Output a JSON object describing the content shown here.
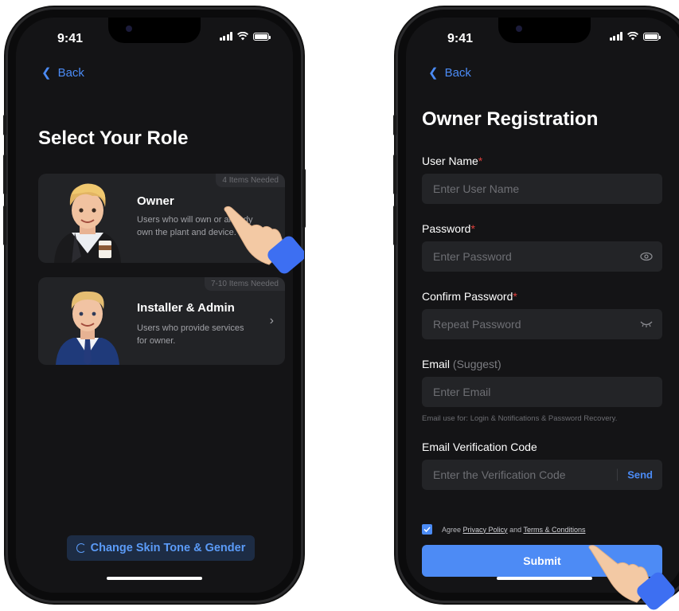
{
  "status": {
    "time": "9:41"
  },
  "nav": {
    "back_label": "Back"
  },
  "role_screen": {
    "title": "Select Your Role",
    "cards": [
      {
        "badge": "4 Items Needed",
        "name": "Owner",
        "description": "Users who will own or already own the plant and device."
      },
      {
        "badge": "7-10 Items Needed",
        "name": "Installer & Admin",
        "description": "Users who provide services for owner."
      }
    ],
    "skin_button": "Change Skin Tone & Gender"
  },
  "registration": {
    "title": "Owner Registration",
    "fields": [
      {
        "label": "User Name",
        "required": "*",
        "placeholder": "Enter User Name"
      },
      {
        "label": "Password",
        "required": "*",
        "placeholder": "Enter Password"
      },
      {
        "label": "Confirm Password",
        "required": "*",
        "placeholder": "Repeat Password"
      },
      {
        "label": "Email",
        "optional": "(Suggest)",
        "placeholder": "Enter Email"
      },
      {
        "label": "Email Verification Code",
        "placeholder": "Enter the Verification Code"
      }
    ],
    "email_hint": "Email use for: Login & Notifications & Password Recovery.",
    "send_label": "Send",
    "agree": {
      "prefix": "Agree",
      "privacy": "Privacy Policy",
      "and": "and",
      "terms": "Terms & Conditions"
    },
    "submit_label": "Submit"
  },
  "colors": {
    "accent": "#4d8bf5",
    "background": "#141416",
    "card": "#222326",
    "required": "#e0403c"
  }
}
